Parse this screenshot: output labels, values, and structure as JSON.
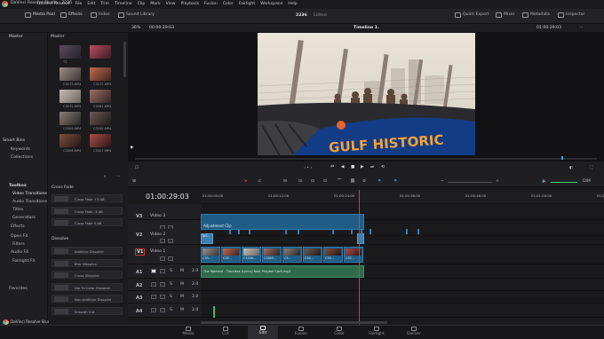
{
  "app": {
    "title": "DaVinci Resolve Studio - 2236",
    "menu": [
      "DaVinci Resolve",
      "File",
      "Edit",
      "Trim",
      "Timeline",
      "Clip",
      "Mark",
      "View",
      "Playback",
      "Fusion",
      "Color",
      "Fairlight",
      "Workspace",
      "Help"
    ]
  },
  "toolbar": {
    "media_pool": "Media Pool",
    "effects": "Effects",
    "index": "Index",
    "sound_library": "Sound Library",
    "project_name": "2236",
    "project_status": "Edited",
    "quick_export": "Quick Export",
    "mixer": "Mixer",
    "metadata": "Metadata",
    "inspector": "Inspector"
  },
  "viewer_bar": {
    "zoom": "36%",
    "source_tc": "00:00:29:03",
    "timeline_name": "Timeline 1",
    "record_tc": "01:00:29:03"
  },
  "media_pool": {
    "bin_title": "Master",
    "list_title": "Master",
    "smart_bins": "Smart Bins",
    "keywords": "Keywords",
    "collections": "Collections",
    "clips": [
      "T2",
      "",
      "C3273.MP4",
      "C3277.MP4",
      "C3275.MP4",
      "C3281.MP4",
      "C3305.MP4",
      "C3292.MP4",
      "C3306.MP4",
      "C3307.MP4"
    ]
  },
  "video": {
    "banner_text": "GULF HISTORIC"
  },
  "toolbox": {
    "title": "Toolbox",
    "items": [
      "Video Transitions",
      "Audio Transitions",
      "Titles",
      "Generators",
      "Effects",
      "Open FX",
      "Filters",
      "Audio FX",
      "Fairlight FX"
    ],
    "favorites": "Favorites",
    "brand": "DaVinci Resolve Studio 18"
  },
  "effects": {
    "cross_fade_title": "Cross Fade",
    "cross_fades": [
      "Cross Fade +3 dB",
      "Cross Fade -3 dB",
      "Cross Fade 0 dB"
    ],
    "dissolve_title": "Dissolve",
    "dissolves": [
      "Additive Dissolve",
      "Blur Dissolve",
      "Cross Dissolve",
      "Dip To Color Dissolve",
      "Non-Additive Dissolve",
      "Smooth Cut"
    ]
  },
  "timeline": {
    "timecode": "01:00:29:03",
    "ruler": [
      "01:00:00:00",
      "01:00:12:00",
      "01:00:24:00",
      "01:00:36:00",
      "01:00:48:00",
      "01:01:00:00",
      "01:01:12:00"
    ],
    "tracks": {
      "v3": {
        "id": "V3",
        "name": "Video 3"
      },
      "v2": {
        "id": "V2",
        "name": "Video 2"
      },
      "v1": {
        "id": "V1",
        "name": "Video 1"
      },
      "a1": {
        "id": "A1",
        "vol": "2.0"
      },
      "a2": {
        "id": "A2",
        "vol": "2.0"
      },
      "a3": {
        "id": "A3",
        "vol": "2.0"
      },
      "a4": {
        "id": "A4",
        "vol": "2.0"
      }
    },
    "adjustment_clip": "Adjustment Clip",
    "v1_clips": [
      "C33...",
      "C33...",
      "C3306...",
      "C3305...",
      "C3...",
      "C33...",
      "C33...",
      "C33..."
    ],
    "audio_clip": "The Weeknd - Timeless (Lyrics) feat. Playboi Carti.mp3",
    "dim_label": "DIM"
  },
  "pages": [
    "Media",
    "Cut",
    "Edit",
    "Fusion",
    "Color",
    "Fairlight",
    "Deliver"
  ],
  "active_page": "Edit",
  "colors": {
    "accent": "#e3442e",
    "playhead": "#e03b2f",
    "video_clip": "#1f5d86",
    "audio_clip": "#2e6a4e",
    "selected_track": "#c23a32"
  }
}
